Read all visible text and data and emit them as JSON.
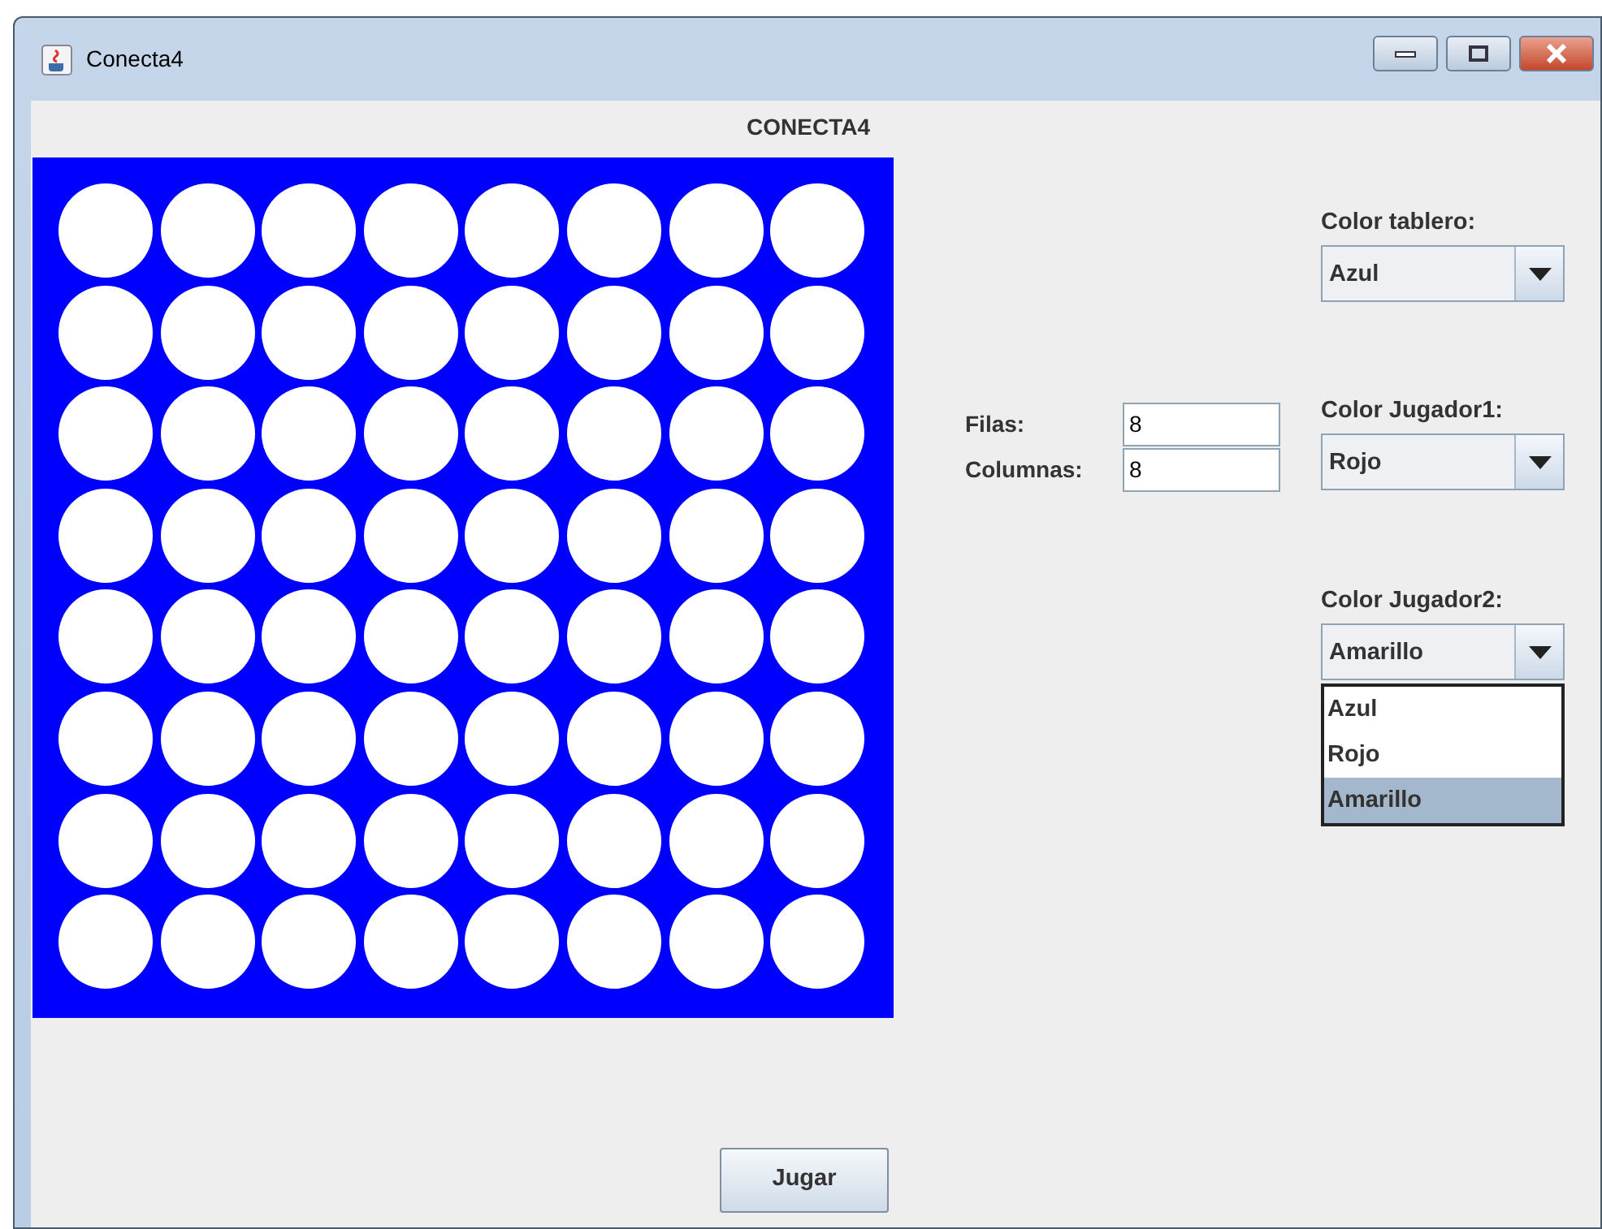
{
  "window": {
    "title": "Conecta4"
  },
  "heading": "CONECTA4",
  "board": {
    "color": "#0000ff"
  },
  "fields": [
    {
      "label": "Filas:",
      "value": "8"
    },
    {
      "label": "Columnas:",
      "value": "8"
    }
  ],
  "combos": [
    {
      "label": "Color tablero:",
      "value": "Azul"
    },
    {
      "label": "Color Jugador1:",
      "value": "Rojo"
    },
    {
      "label": "Color Jugador2:",
      "value": "Amarillo",
      "options": [
        {
          "label": "Azul",
          "selected": false
        },
        {
          "label": "Rojo",
          "selected": false
        },
        {
          "label": "Amarillo",
          "selected": true
        }
      ]
    }
  ],
  "button": "Jugar"
}
